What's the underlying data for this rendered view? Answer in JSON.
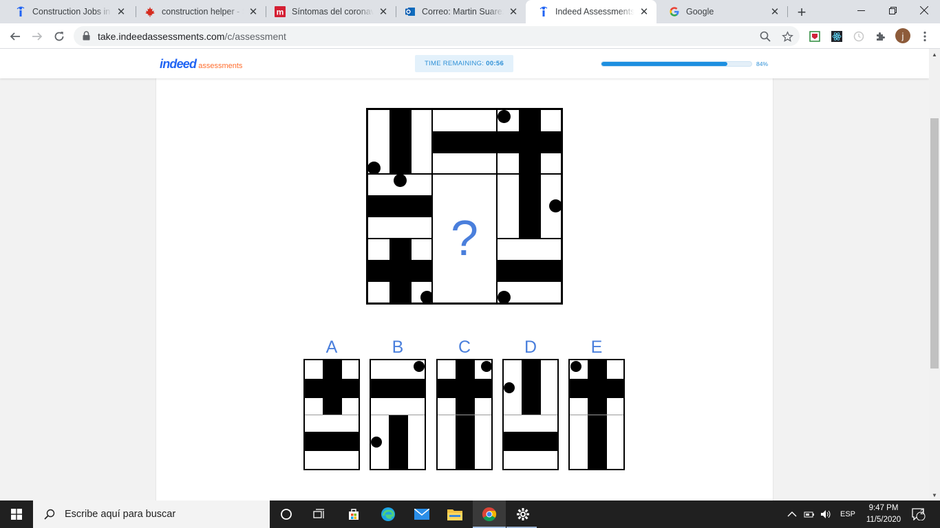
{
  "browser": {
    "tabs": [
      {
        "title": "Construction Jobs in Ca",
        "icon": "indeed-favicon",
        "active": false
      },
      {
        "title": "construction helper - Su",
        "icon": "maple-leaf-favicon",
        "active": false
      },
      {
        "title": "Síntomas del coronaviru",
        "icon": "m-favicon",
        "active": false
      },
      {
        "title": "Correo: Martin Suarez -",
        "icon": "outlook-favicon",
        "active": false
      },
      {
        "title": "Indeed Assessments",
        "icon": "indeed-favicon",
        "active": true
      },
      {
        "title": "Google",
        "icon": "google-favicon",
        "active": false
      }
    ],
    "url_host": "take.indeedassessments.com",
    "url_path": "/c/assessment",
    "profile_initial": "j"
  },
  "header": {
    "logo_brand": "indeed",
    "logo_sub": "assessments",
    "timer_label": "TIME REMAINING:",
    "timer_value": "00:56",
    "progress_percent": 84,
    "progress_label": "84%"
  },
  "puzzle": {
    "missing_mark": "?",
    "options": [
      "A",
      "B",
      "C",
      "D",
      "E"
    ]
  },
  "taskbar": {
    "search_placeholder": "Escribe aquí para buscar",
    "language": "ESP",
    "time": "9:47 PM",
    "date": "11/5/2020",
    "notification_count": "2"
  }
}
